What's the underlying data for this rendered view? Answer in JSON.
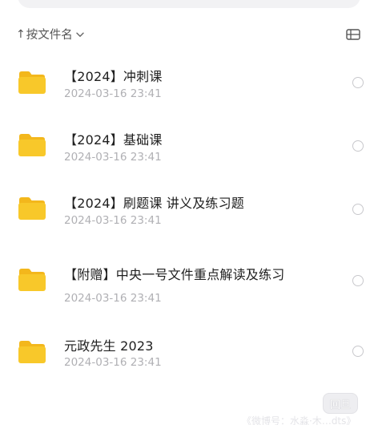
{
  "sort": {
    "arrow": "↑",
    "label": "按文件名",
    "chevron_icon": "chevron-down-icon",
    "view_toggle_icon": "list-view-icon"
  },
  "files": [
    {
      "name": "【2024】冲刺课",
      "date": "2024-03-16 23:41",
      "icon": "folder-icon"
    },
    {
      "name": "【2024】基础课",
      "date": "2024-03-16 23:41",
      "icon": "folder-icon"
    },
    {
      "name": "【2024】刷题课 讲义及练习题",
      "date": "2024-03-16 23:41",
      "icon": "folder-icon"
    },
    {
      "name": "【附赠】中央一号文件重点解读及练习",
      "date": "2024-03-16 23:41",
      "icon": "folder-icon"
    },
    {
      "name": "元政先生 2023",
      "date": "2024-03-16 23:41",
      "icon": "folder-icon"
    }
  ],
  "float_button": {
    "label": "回旦"
  },
  "watermark": {
    "text": "《微博号：水淼·木…dts》"
  },
  "colors": {
    "folder_body": "#f8c82a",
    "folder_tab": "#f3b71c",
    "date_text": "#b0b0b4",
    "radio_border": "#c8c8cc"
  }
}
